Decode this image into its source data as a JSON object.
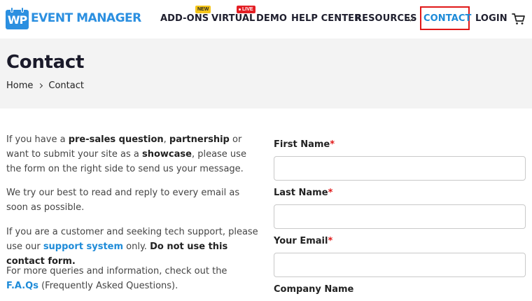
{
  "brand": {
    "logo_mark": "WP",
    "name": "EVENT MANAGER",
    "color": "#2b8fe0"
  },
  "nav": {
    "items": [
      {
        "label": "ADD-ONS",
        "badge": "NEW"
      },
      {
        "label": "VIRTUAL",
        "badge": "LIVE"
      },
      {
        "label": "DEMO"
      },
      {
        "label": "HELP CENTER"
      },
      {
        "label": "RESOURCES"
      },
      {
        "label": "CONTACT",
        "active": true
      },
      {
        "label": "LOGIN"
      }
    ],
    "cart_icon": "cart-icon",
    "highlight_color": "#e01818"
  },
  "page": {
    "title": "Contact",
    "breadcrumb": {
      "home": "Home",
      "current": "Contact"
    }
  },
  "intro": {
    "p1": {
      "a": "If you have a ",
      "b": "pre-sales question",
      "c": ", ",
      "d": "partnership",
      "e": " or want to submit your site as a ",
      "f": "showcase",
      "g": ", please use the form on the right side to send us your message."
    },
    "p2": "We try our best to read and reply to every email as soon as possible.",
    "p3": {
      "a": "If you are a customer and seeking tech support, please use our ",
      "link": "support system",
      "b": " only. ",
      "c": "Do not use this contact form."
    },
    "p4": {
      "a": "For more queries and information, check out the ",
      "link": "F.A.Qs",
      "b": " (Frequently Asked Questions)."
    }
  },
  "form": {
    "fields": [
      {
        "label": "First Name",
        "required": "*",
        "value": ""
      },
      {
        "label": "Last Name",
        "required": "*",
        "value": ""
      },
      {
        "label": "Your Email",
        "required": "*",
        "value": ""
      },
      {
        "label": "Company Name",
        "required": ""
      }
    ]
  }
}
